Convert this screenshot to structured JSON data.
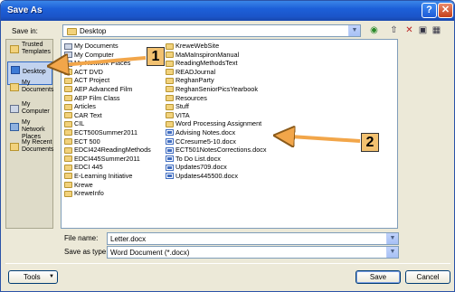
{
  "window": {
    "title": "Save As",
    "help_glyph": "?",
    "close_glyph": "✕"
  },
  "savein": {
    "label": "Save in:",
    "value": "Desktop"
  },
  "toolbar_icons": [
    "back-icon",
    "up-folder-icon",
    "delete-icon",
    "new-folder-icon",
    "views-icon"
  ],
  "places": [
    {
      "label": "Trusted Templates",
      "icon": "folder-icon"
    },
    {
      "label": "Desktop",
      "icon": "desktop-icon",
      "selected": true
    },
    {
      "label": "My Documents",
      "icon": "documents-icon"
    },
    {
      "label": "My Computer",
      "icon": "computer-icon"
    },
    {
      "label": "My Network Places",
      "icon": "network-icon"
    },
    {
      "label": "My Recent Documents",
      "icon": "recent-icon"
    }
  ],
  "files": {
    "col1": [
      {
        "name": "My Documents",
        "type": "sys"
      },
      {
        "name": "My Computer",
        "type": "sys"
      },
      {
        "name": "My Network Places",
        "type": "sys"
      },
      {
        "name": "ACT DVD",
        "type": "fld"
      },
      {
        "name": "ACT Project",
        "type": "fld"
      },
      {
        "name": "AEP Advanced Film",
        "type": "fld"
      },
      {
        "name": "AEP Film Class",
        "type": "fld"
      },
      {
        "name": "Articles",
        "type": "fld"
      },
      {
        "name": "CAR Text",
        "type": "fld"
      },
      {
        "name": "CIL",
        "type": "fld"
      },
      {
        "name": "ECT500Summer2011",
        "type": "fld"
      },
      {
        "name": "ECT 500",
        "type": "fld"
      },
      {
        "name": "EDCI424ReadingMethods",
        "type": "fld"
      },
      {
        "name": "EDCI445Summer2011",
        "type": "fld"
      },
      {
        "name": "EDCI 445",
        "type": "fld"
      },
      {
        "name": "E-Learning Initiative",
        "type": "fld"
      },
      {
        "name": "Krewe",
        "type": "fld"
      },
      {
        "name": "KreweInfo",
        "type": "fld"
      }
    ],
    "col2": [
      {
        "name": "KreweWebSite",
        "type": "fld"
      },
      {
        "name": "MaMaInspironManual",
        "type": "fld"
      },
      {
        "name": "ReadingMethodsText",
        "type": "fld"
      },
      {
        "name": "READJournal",
        "type": "fld"
      },
      {
        "name": "ReghanParty",
        "type": "fld"
      },
      {
        "name": "ReghanSeniorPicsYearbook",
        "type": "fld"
      },
      {
        "name": "Resources",
        "type": "fld"
      },
      {
        "name": "Stuff",
        "type": "fld"
      },
      {
        "name": "VITA",
        "type": "fld"
      },
      {
        "name": "Word Processing Assignment",
        "type": "fld"
      },
      {
        "name": "Advising Notes.docx",
        "type": "doc"
      },
      {
        "name": "CCresume5-10.docx",
        "type": "doc"
      },
      {
        "name": "ECT501NotesCorrections.docx",
        "type": "doc"
      },
      {
        "name": "To Do List.docx",
        "type": "doc"
      },
      {
        "name": "Updates709.docx",
        "type": "doc"
      },
      {
        "name": "Updates445500.docx",
        "type": "doc"
      }
    ]
  },
  "filename": {
    "label": "File name:",
    "value": "Letter.docx"
  },
  "savetype": {
    "label": "Save as type:",
    "value": "Word Document (*.docx)"
  },
  "buttons": {
    "tools": "Tools",
    "save": "Save",
    "cancel": "Cancel"
  },
  "callouts": [
    "1",
    "2"
  ],
  "colors": {
    "title_bar": "#1c5fd8",
    "callout_fill": "#f2c170"
  }
}
